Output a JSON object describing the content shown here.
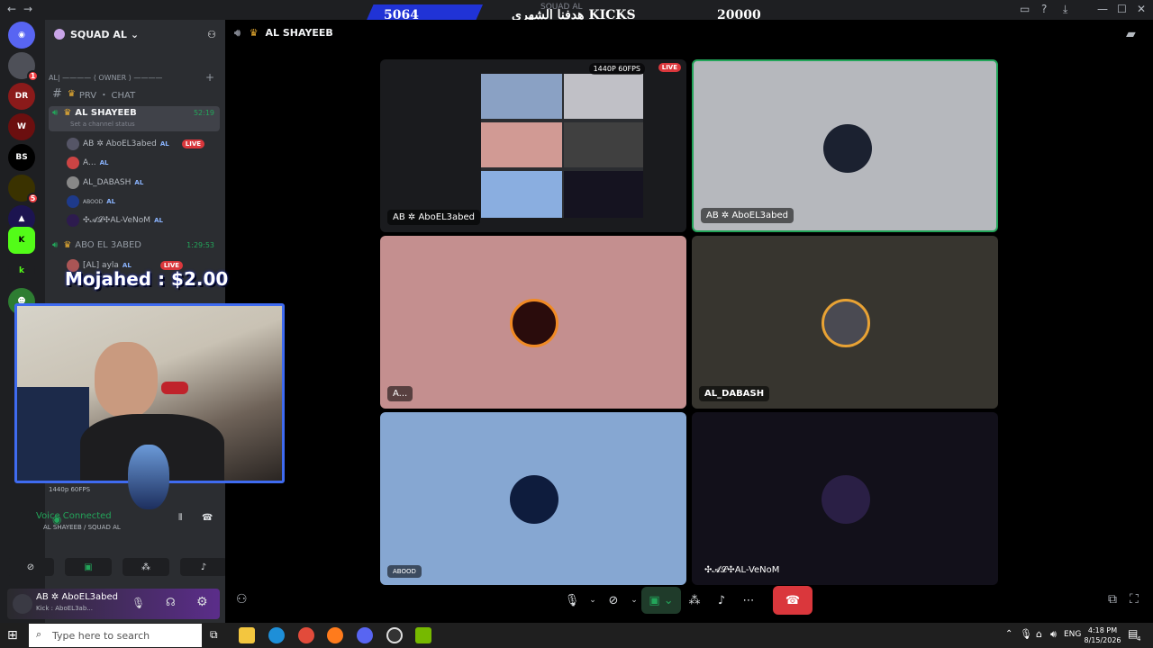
{
  "stream_bar": {
    "kicks_count": "5064",
    "goal_label": "هدفنا الشهري KICKS",
    "goal_target": "20000",
    "window_title": "SQUAD AL"
  },
  "server": {
    "name": "SQUAD AL",
    "category": "AL| ———— ⟨ OWNER ⟩ ————",
    "channels": [
      {
        "label": "PRV ・ CHAT"
      },
      {
        "label": "AL SHAYEEB",
        "time": "52:19",
        "status": "Set a channel status"
      },
      {
        "label": "ABO EL 3ABED",
        "time": "1:29:53"
      }
    ],
    "members": [
      {
        "name": "AB ✲ AboEL3abed",
        "tag": "AL",
        "live": "LIVE"
      },
      {
        "name": "A...",
        "tag": "AL"
      },
      {
        "name": "AL_DABASH",
        "tag": "AL"
      },
      {
        "name": "ABOOD",
        "tag": "AL"
      },
      {
        "name": "✣𝓐𝓛✣AL-VeNoM",
        "tag": "AL"
      },
      {
        "name": "[AL] ayla",
        "tag": "AL",
        "live": "LIVE"
      }
    ]
  },
  "donation": {
    "text": "Mojahed : $2.00"
  },
  "voice": {
    "status": "Voice Connected",
    "channel": "AL SHAYEEB / SQUAD AL",
    "quality": "1440p 60FPS"
  },
  "user": {
    "name": "AB ✲ AboEL3abed",
    "status": "Kick : AboEL3ab..."
  },
  "main": {
    "header": "AL SHAYEEB",
    "stream_badge": "1440P 60FPS",
    "live": "LIVE",
    "tiles": [
      {
        "label": "AB ✲ AboEL3abed",
        "color": "#1a1b1e"
      },
      {
        "label": "AB ✲ AboEL3abed",
        "color": "#b6b8bd"
      },
      {
        "label": "A...",
        "color": "#c48f8f"
      },
      {
        "label": "AL_DABASH",
        "color": "#37352f"
      },
      {
        "label": "ABOOD",
        "color": "#86a7d2"
      },
      {
        "label": "✣𝓐𝓛✣AL-VeNoM",
        "color": "#12101a"
      }
    ]
  },
  "taskbar": {
    "search_placeholder": "Type here to search",
    "lang": "ENG",
    "time": "4:18 PM",
    "date": "8/15/2026",
    "notif_count": "4"
  }
}
